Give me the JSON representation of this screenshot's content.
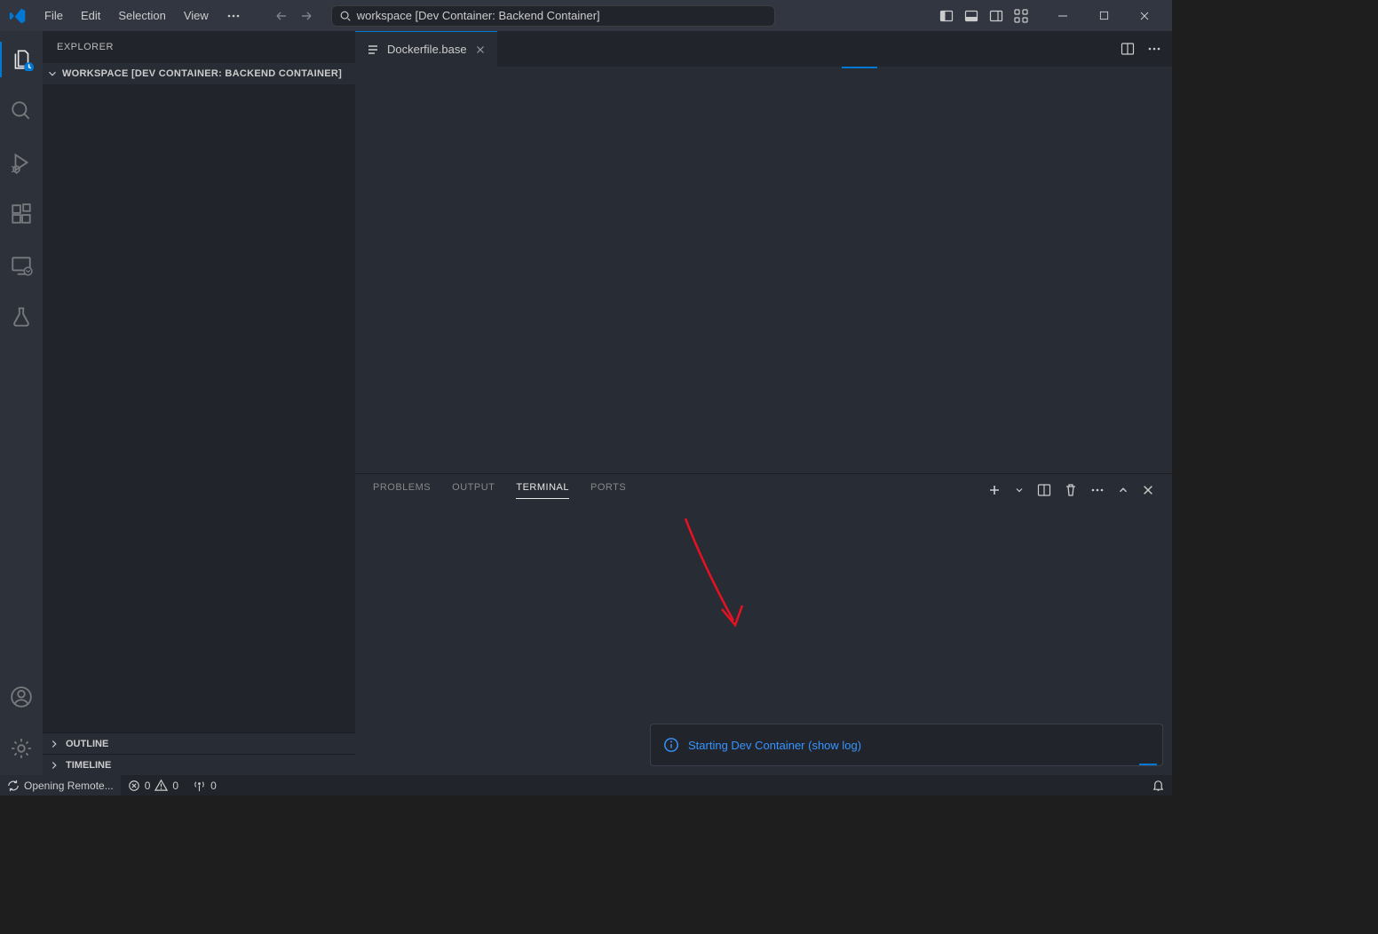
{
  "menu": {
    "file": "File",
    "edit": "Edit",
    "selection": "Selection",
    "view": "View"
  },
  "search_text": "workspace [Dev Container: Backend Container]",
  "sidebar": {
    "title": "EXPLORER",
    "workspace": "WORKSPACE [DEV CONTAINER: BACKEND CONTAINER]",
    "sections": {
      "outline": "OUTLINE",
      "timeline": "TIMELINE"
    }
  },
  "tab": {
    "label": "Dockerfile.base"
  },
  "panel": {
    "tabs": {
      "problems": "PROBLEMS",
      "output": "OUTPUT",
      "terminal": "TERMINAL",
      "ports": "PORTS"
    }
  },
  "toast": {
    "text": "Starting Dev Container (show log)"
  },
  "statusbar": {
    "remote": "Opening Remote...",
    "errors": "0",
    "warnings": "0",
    "ports": "0"
  }
}
